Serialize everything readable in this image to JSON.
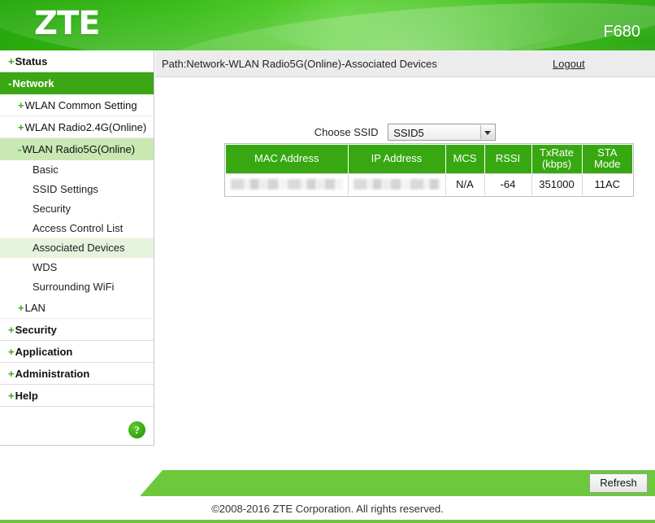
{
  "header": {
    "brand": "ZTE",
    "model": "F680"
  },
  "sidebar": {
    "top_items": [
      {
        "sign": "+",
        "label": "Status",
        "state": "collapsed"
      },
      {
        "sign": "-",
        "label": "Network",
        "state": "active"
      }
    ],
    "network_children": [
      {
        "sign": "+",
        "label": "WLAN Common Setting",
        "state": "collapsed"
      },
      {
        "sign": "+",
        "label": "WLAN Radio2.4G(Online)",
        "state": "collapsed"
      },
      {
        "sign": "-",
        "label": "WLAN Radio5G(Online)",
        "state": "expanded"
      }
    ],
    "radio5g_children": [
      {
        "label": "Basic",
        "state": "normal"
      },
      {
        "label": "SSID Settings",
        "state": "normal"
      },
      {
        "label": "Security",
        "state": "normal"
      },
      {
        "label": "Access Control List",
        "state": "normal"
      },
      {
        "label": "Associated Devices",
        "state": "selected"
      },
      {
        "label": "WDS",
        "state": "normal"
      },
      {
        "label": "Surrounding WiFi",
        "state": "normal"
      }
    ],
    "lan_item": {
      "sign": "+",
      "label": "LAN",
      "state": "collapsed"
    },
    "bottom_items": [
      {
        "sign": "+",
        "label": "Security",
        "state": "collapsed"
      },
      {
        "sign": "+",
        "label": "Application",
        "state": "collapsed"
      },
      {
        "sign": "+",
        "label": "Administration",
        "state": "collapsed"
      },
      {
        "sign": "+",
        "label": "Help",
        "state": "collapsed"
      }
    ],
    "help_icon": "?"
  },
  "content": {
    "path": "Path:Network-WLAN Radio5G(Online)-Associated Devices",
    "logout_label": "Logout",
    "ssid_label": "Choose SSID",
    "ssid_selected": "SSID5",
    "ssid_options": [
      "SSID5"
    ]
  },
  "table": {
    "headers": [
      "MAC Address",
      "IP Address",
      "MCS",
      "RSSI",
      "TxRate (kbps)",
      "STA Mode"
    ],
    "header_txrate_line1": "TxRate",
    "header_txrate_line2": "(kbps)",
    "rows": [
      {
        "mac_address": "",
        "ip_address": "",
        "mcs": "N/A",
        "rssi": "-64",
        "txrate_kbps": "351000",
        "sta_mode": "11AC"
      }
    ]
  },
  "footer": {
    "refresh_label": "Refresh",
    "copyright": "©2008-2016 ZTE Corporation. All rights reserved."
  },
  "colors": {
    "brand_green": "#3ba714",
    "table_header_green": "#37a811",
    "footer_green": "#6dc83c",
    "selected_row_green": "#e6f3dc",
    "expanded_green": "#c9e8b4"
  }
}
